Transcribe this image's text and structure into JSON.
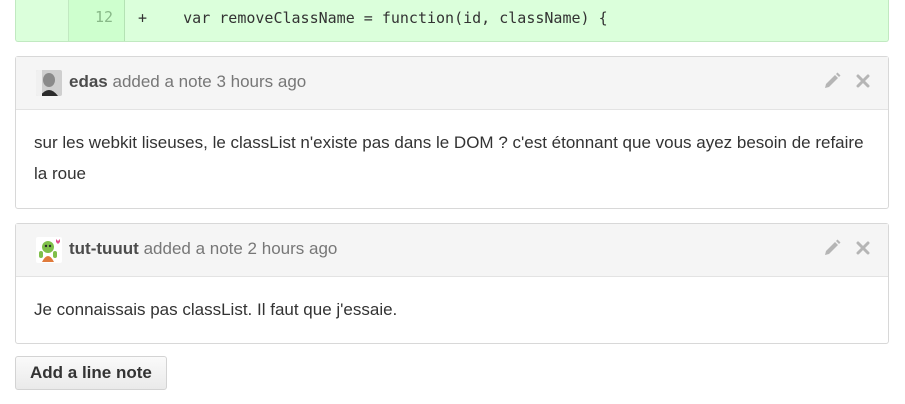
{
  "diff": {
    "line_number": "12",
    "code": "+    var removeClassName = function(id, className) {"
  },
  "comments": [
    {
      "author": "edas",
      "action": "added a note 3 hours ago",
      "body": "sur les webkit liseuses, le classList n'existe pas dans le DOM ? c'est étonnant que vous ayez besoin de refaire la roue",
      "avatar_icon": "user-photo-avatar",
      "edit_icon": "pencil-icon",
      "delete_icon": "close-icon"
    },
    {
      "author": "tut-tuuut",
      "action": "added a note 2 hours ago",
      "body": "Je connaissais pas classList. Il faut que j'essaie.",
      "avatar_icon": "cartoon-avatar",
      "edit_icon": "pencil-icon",
      "delete_icon": "close-icon"
    }
  ],
  "add_note_button": "Add a line note",
  "colors": {
    "diff_added_bg": "#dbffdb",
    "header_bg": "#f5f5f5",
    "icon_gray": "#a8a8a8"
  }
}
